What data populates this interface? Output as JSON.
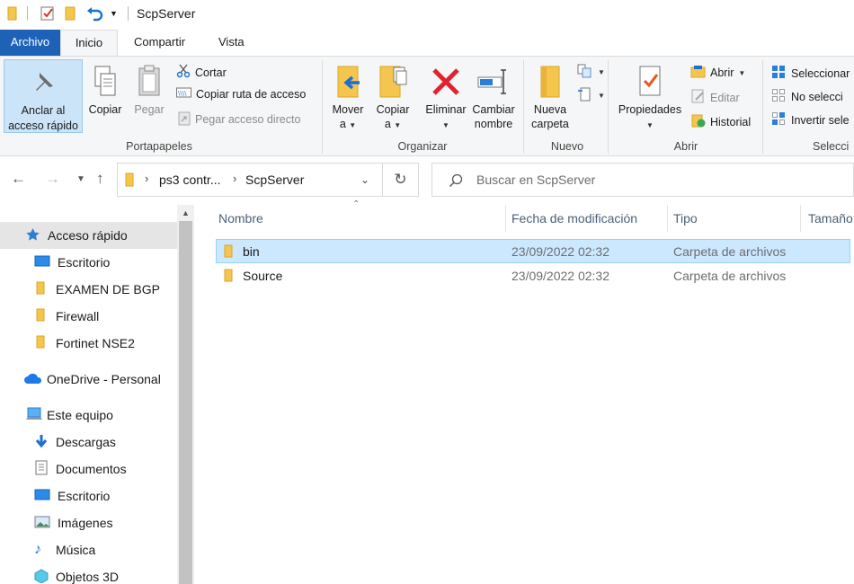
{
  "window": {
    "title": "ScpServer"
  },
  "ribbon_tabs": [
    "Archivo",
    "Inicio",
    "Compartir",
    "Vista"
  ],
  "ribbon": {
    "portapapeles": {
      "label": "Portapapeles",
      "pin": "Anclar al acceso rápido",
      "pin_line1": "Anclar al",
      "pin_line2": "acceso rápido",
      "copy": "Copiar",
      "paste": "Pegar",
      "cut": "Cortar",
      "copy_path": "Copiar ruta de acceso",
      "paste_shortcut": "Pegar acceso directo"
    },
    "organizar": {
      "label": "Organizar",
      "move_line1": "Mover",
      "move_line2": "a",
      "copy_line1": "Copiar",
      "copy_line2": "a",
      "delete": "Eliminar",
      "rename_line1": "Cambiar",
      "rename_line2": "nombre"
    },
    "nuevo": {
      "label": "Nuevo",
      "new_folder_line1": "Nueva",
      "new_folder_line2": "carpeta"
    },
    "abrir": {
      "label": "Abrir",
      "properties": "Propiedades",
      "open": "Abrir",
      "edit": "Editar",
      "history": "Historial"
    },
    "seleccionar": {
      "label": "Selecci",
      "select_all": "Seleccionar",
      "select_none": "No selecci",
      "invert": "Invertir sele"
    }
  },
  "address": {
    "crumbs": [
      "ps3 contr...",
      "ScpServer"
    ]
  },
  "search": {
    "placeholder": "Buscar en ScpServer"
  },
  "nav": {
    "quick_access": "Acceso rápido",
    "quick_items": [
      "Escritorio",
      "EXAMEN DE BGP",
      "Firewall",
      "Fortinet NSE2"
    ],
    "onedrive": "OneDrive - Personal",
    "this_pc": "Este equipo",
    "pc_items": [
      "Descargas",
      "Documentos",
      "Escritorio",
      "Imágenes",
      "Música",
      "Objetos 3D"
    ]
  },
  "columns": [
    "Nombre",
    "Fecha de modificación",
    "Tipo",
    "Tamaño"
  ],
  "files": [
    {
      "name": "bin",
      "date": "23/09/2022 02:32",
      "type": "Carpeta de archivos"
    },
    {
      "name": "Source",
      "date": "23/09/2022 02:32",
      "type": "Carpeta de archivos"
    }
  ]
}
